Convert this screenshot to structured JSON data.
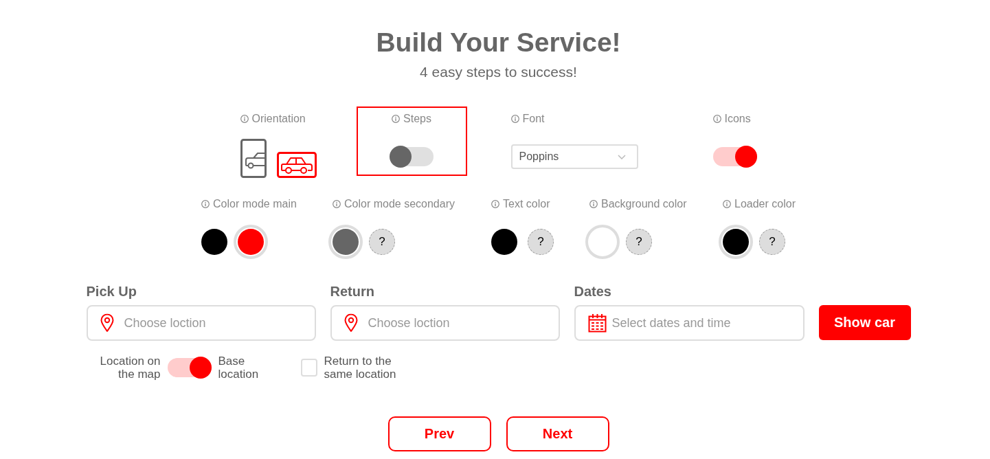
{
  "header": {
    "title": "Build Your Service!",
    "subtitle": "4 easy steps to success!"
  },
  "settings": [
    {
      "kind": "orientation",
      "label": "Orientation",
      "highlighted": false,
      "options": [
        {
          "kind": "portrait",
          "selected": false
        },
        {
          "kind": "landscape",
          "selected": true
        }
      ]
    },
    {
      "kind": "toggle",
      "label": "Steps",
      "highlighted": true,
      "on": false
    },
    {
      "kind": "dropdown",
      "label": "Font",
      "highlighted": false,
      "value": "Poppins"
    },
    {
      "kind": "toggle",
      "label": "Icons",
      "highlighted": false,
      "on": true
    }
  ],
  "colors": [
    {
      "label": "Color mode main",
      "swatches": [
        {
          "kind": "color",
          "color": "#000000",
          "selected": false
        },
        {
          "kind": "color",
          "color": "#ff0000",
          "selected": true
        }
      ]
    },
    {
      "label": "Color mode secondary",
      "swatches": [
        {
          "kind": "color",
          "color": "#666666",
          "selected": true
        },
        {
          "kind": "custom",
          "label": "?",
          "selected": false
        }
      ]
    },
    {
      "label": "Text color",
      "swatches": [
        {
          "kind": "color",
          "color": "#000000",
          "selected": false
        },
        {
          "kind": "custom",
          "label": "?",
          "selected": false
        }
      ]
    },
    {
      "label": "Background color",
      "swatches": [
        {
          "kind": "color",
          "color": "#ffffff",
          "selected": true
        },
        {
          "kind": "custom",
          "label": "?",
          "selected": false
        }
      ]
    },
    {
      "label": "Loader color",
      "swatches": [
        {
          "kind": "color",
          "color": "#000000",
          "selected": true
        },
        {
          "kind": "custom",
          "label": "?",
          "selected": false
        }
      ]
    }
  ],
  "form": {
    "fields": [
      {
        "kind": "location",
        "label": "Pick Up",
        "placeholder": "Choose loction"
      },
      {
        "kind": "location",
        "label": "Return",
        "placeholder": "Choose loction"
      },
      {
        "kind": "dates",
        "label": "Dates",
        "placeholder": "Select dates and time"
      }
    ],
    "submit": "Show car",
    "options": [
      {
        "kind": "switch",
        "left_label": "Location on the map",
        "right_label": "Base location",
        "on": true
      },
      {
        "kind": "checkbox",
        "label": "Return to the same location",
        "checked": false
      }
    ]
  },
  "nav": [
    "Prev",
    "Next"
  ]
}
